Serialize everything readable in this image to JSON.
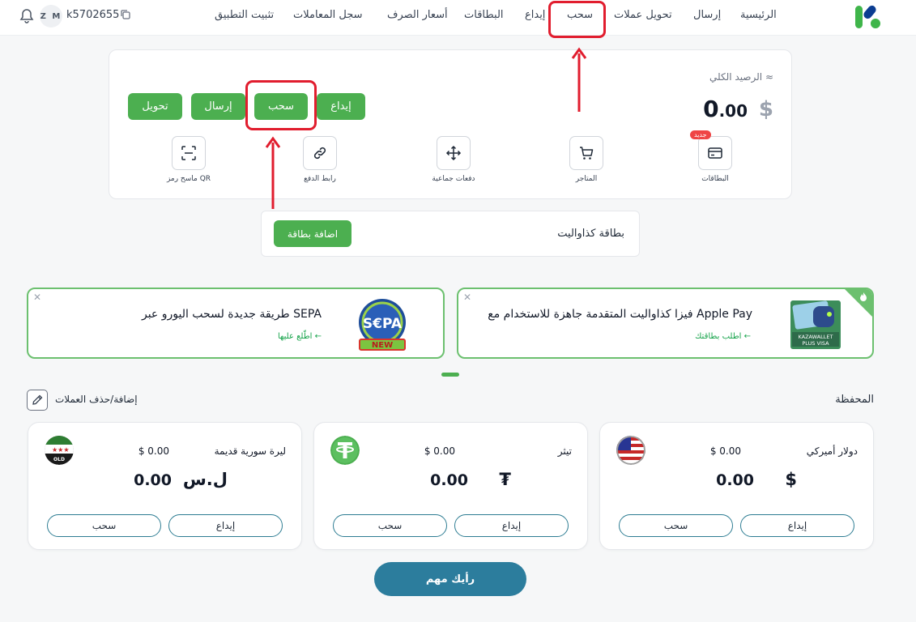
{
  "nav": {
    "items": [
      {
        "label": "الرئيسية"
      },
      {
        "label": "إرسال"
      },
      {
        "label": "تحويل عملات"
      },
      {
        "label": "سحب"
      },
      {
        "label": "إيداع"
      },
      {
        "label": "البطاقات"
      },
      {
        "label": "أسعار الصرف"
      },
      {
        "label": "سجل المعاملات"
      },
      {
        "label": "تثبيت التطبيق"
      }
    ],
    "account_id": "k5702655",
    "avatar_initials": "Z M",
    "icons": {
      "logo": "kazawallet-logo",
      "bell": "bell-icon",
      "copy": "copy-icon"
    }
  },
  "balance": {
    "label": "الرصيد الكلي ≈",
    "whole": "0",
    "decimals": ".00",
    "currency": "$",
    "actions": [
      {
        "label": "إيداع"
      },
      {
        "label": "سحب"
      },
      {
        "label": "إرسال"
      },
      {
        "label": "تحويل"
      }
    ],
    "quick": [
      {
        "label": "البطاقات",
        "icon": "card-icon",
        "badge": "جديد"
      },
      {
        "label": "المتاجر",
        "icon": "cart-icon"
      },
      {
        "label": "دفعات جماعية",
        "icon": "move-icon"
      },
      {
        "label": "رابط الدفع",
        "icon": "link-icon"
      },
      {
        "label": "ماسح رمز QR",
        "icon": "scan-icon"
      }
    ]
  },
  "kazacard": {
    "title": "بطاقة كذاواليت",
    "button": "اضافة بطاقة"
  },
  "promos": [
    {
      "title": "فيزا كذاواليت المتقدمة جاهزة للاستخدام مع Apple Pay",
      "link": "اطلب بطاقتك ←",
      "image_text": "KAZAWALLET PLUS VISA"
    },
    {
      "title": "طريقة جديدة لسحب اليورو عبر SEPA",
      "link": "اطّلع عليها ←",
      "image_text": "S€PA",
      "image_badge": "NEW"
    }
  ],
  "wallet": {
    "title": "المحفظة",
    "edit_label": "إضافة/حذف العملات",
    "currencies": [
      {
        "name": "دولار أميركي",
        "usd": "$ 0.00",
        "amount": "0.00",
        "symbol": "$",
        "flag": "us-flag-icon",
        "deposit": "إيداع",
        "withdraw": "سحب"
      },
      {
        "name": "تيثر",
        "usd": "$ 0.00",
        "amount": "0.00",
        "symbol": "₮",
        "flag": "tether-icon",
        "deposit": "إيداع",
        "withdraw": "سحب"
      },
      {
        "name": "ليرة سورية قديمة",
        "usd": "$ 0.00",
        "amount": "0.00",
        "symbol": "ل.س",
        "flag": "syria-old-flag-icon",
        "flag_text": "OLD",
        "deposit": "إيداع",
        "withdraw": "سحب"
      }
    ]
  },
  "feedback": {
    "label": "رأيك مهم"
  },
  "colors": {
    "primary_green": "#4caf50",
    "highlight_red": "#e11d2e",
    "teal": "#2c7d9d"
  }
}
